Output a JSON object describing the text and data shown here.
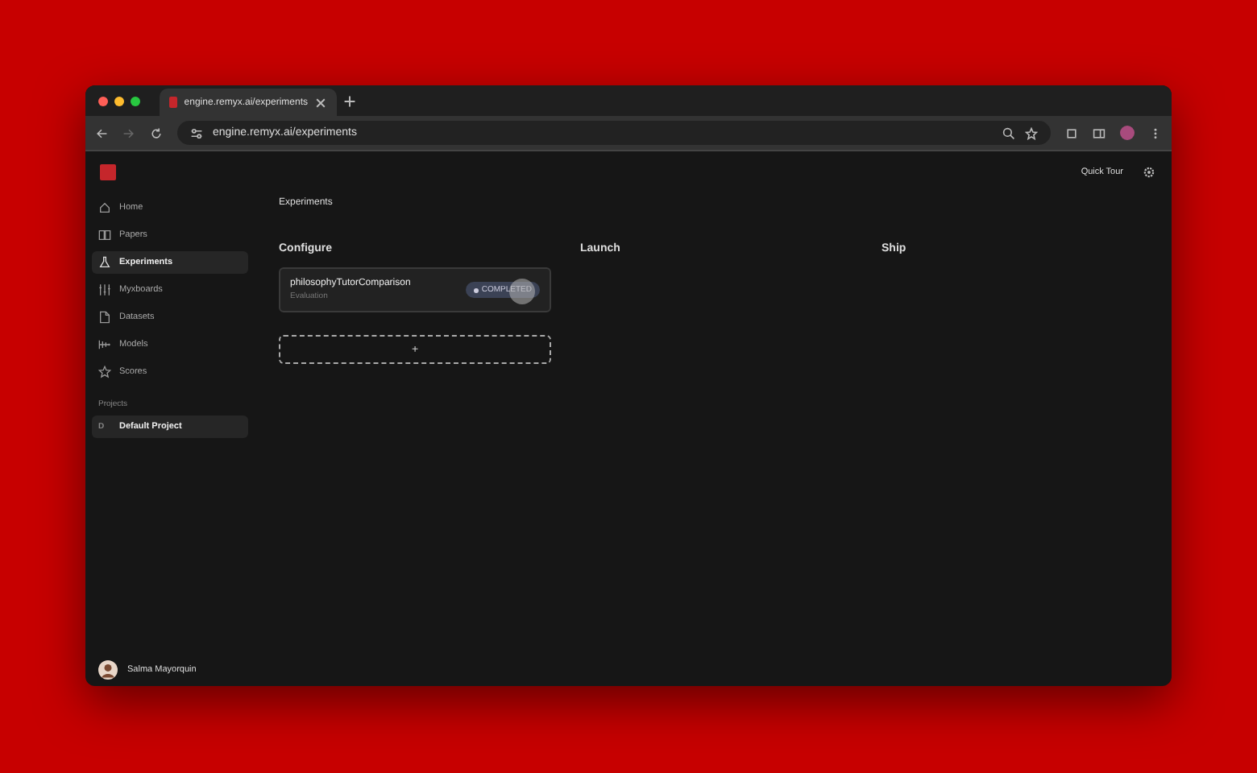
{
  "browser": {
    "tab_title": "engine.remyx.ai/experiments",
    "url": "engine.remyx.ai/experiments"
  },
  "header": {
    "quick_tour": "Quick Tour"
  },
  "sidebar": {
    "items": [
      {
        "label": "Home",
        "selected": false
      },
      {
        "label": "Papers",
        "selected": false
      },
      {
        "label": "Experiments",
        "selected": true
      },
      {
        "label": "Myxboards",
        "selected": false
      },
      {
        "label": "Datasets",
        "selected": false
      },
      {
        "label": "Models",
        "selected": false
      },
      {
        "label": "Scores",
        "selected": false
      }
    ],
    "projects_heading": "Projects",
    "projects": [
      {
        "initial": "D",
        "label": "Default Project",
        "selected": true
      }
    ],
    "user": {
      "name": "Salma Mayorquin"
    }
  },
  "page_title": "Experiments",
  "columns": [
    {
      "title": "Configure",
      "cards": [
        {
          "name": "philosophyTutorComparison",
          "type": "Evaluation",
          "status": "COMPLETED"
        }
      ],
      "add_button": "+"
    },
    {
      "title": "Launch"
    },
    {
      "title": "Ship"
    }
  ]
}
